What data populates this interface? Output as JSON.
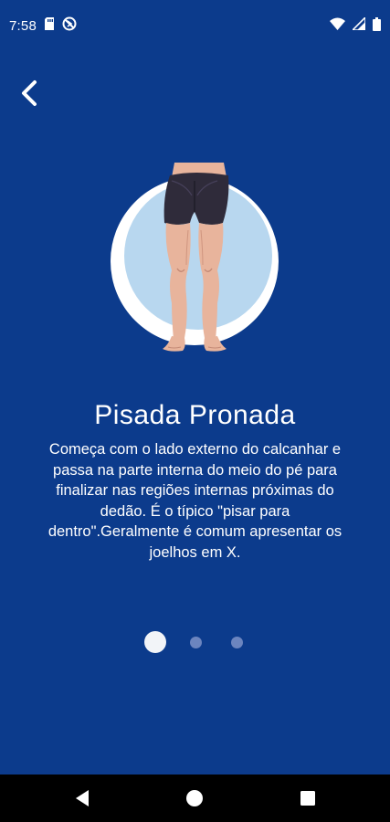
{
  "status_bar": {
    "time": "7:58",
    "left_icons": [
      "sd-card-icon",
      "no-sync-icon"
    ],
    "right_icons": [
      "wifi-icon",
      "signal-icon",
      "battery-icon"
    ]
  },
  "header": {
    "back_icon": "chevron-left-icon"
  },
  "slide": {
    "illustration": "pronated-feet-legs-illustration",
    "title": "Pisada Pronada",
    "description": "Começa com o lado externo do calcanhar e passa na parte interna do meio do pé para finalizar nas regiões internas próximas do dedão. É o típico \"pisar para dentro\".Geralmente é comum apresentar os joelhos em X."
  },
  "pager": {
    "total": 3,
    "active_index": 0
  },
  "nav_bar": {
    "buttons": [
      "back-triangle-icon",
      "home-circle-icon",
      "recents-square-icon"
    ]
  },
  "colors": {
    "background": "#0c3b8c",
    "circle_light": "#b8d7ef",
    "circle_white": "#ffffff",
    "shorts": "#2f2b3a",
    "skin": "#e8b49c",
    "dot_active": "#f2f4f8",
    "dot_inactive": "#6c85bf"
  }
}
